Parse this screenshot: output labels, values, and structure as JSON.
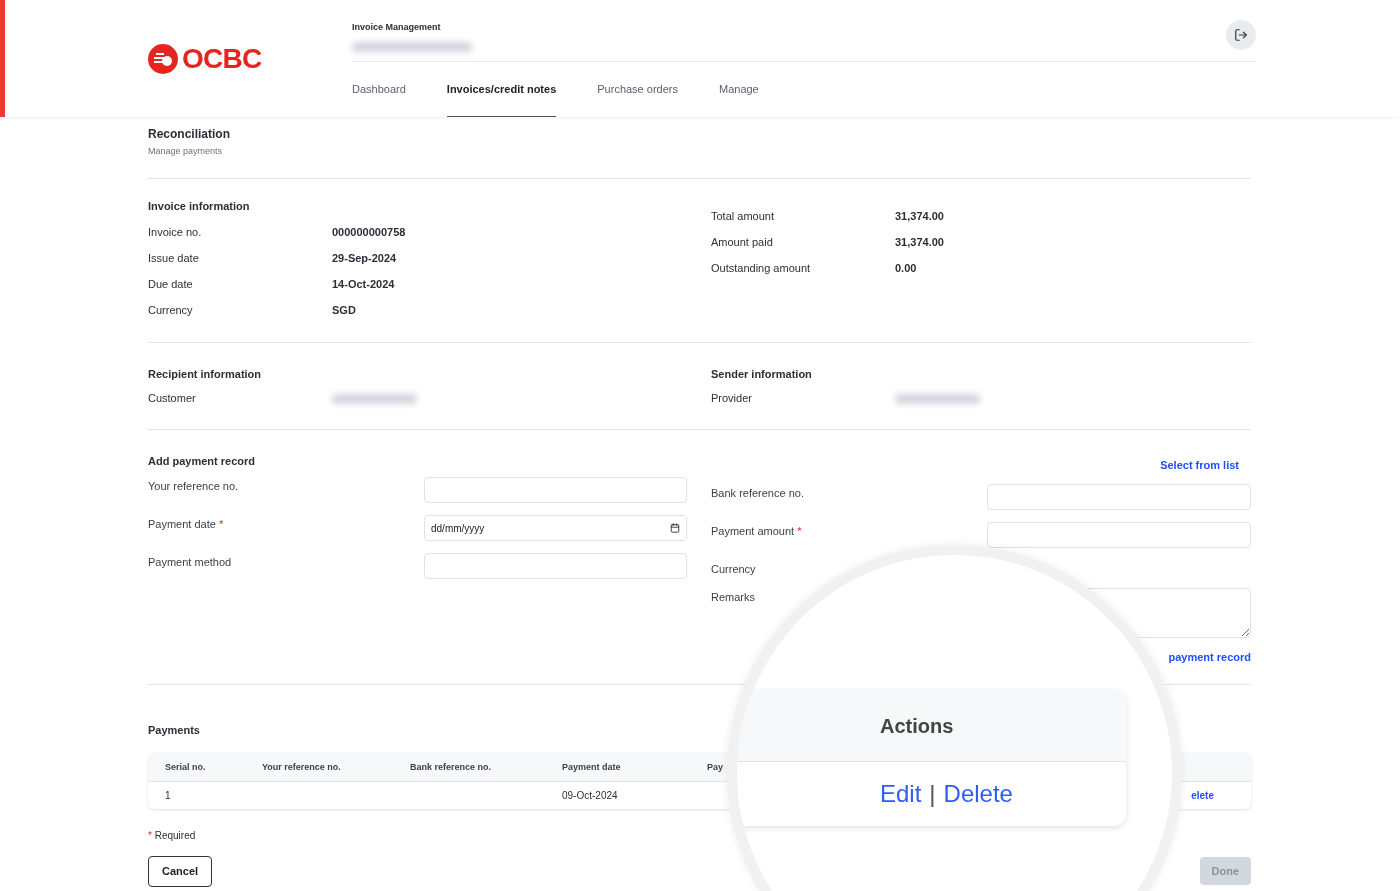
{
  "header": {
    "title": "Invoice Management",
    "logo_text": "OCBC",
    "tabs": [
      {
        "label": "Dashboard",
        "selected": false
      },
      {
        "label": "Invoices/credit notes",
        "selected": true
      },
      {
        "label": "Purchase orders",
        "selected": false
      },
      {
        "label": "Manage",
        "selected": false
      }
    ]
  },
  "page": {
    "title": "Reconciliation",
    "subtitle": "Manage payments"
  },
  "required_mark": "*",
  "invoice_information": {
    "heading": "Invoice information",
    "fields": [
      {
        "label": "Invoice no.",
        "value": "000000000758"
      },
      {
        "label": "Issue date",
        "value": "29-Sep-2024"
      },
      {
        "label": "Due date",
        "value": "14-Oct-2024"
      },
      {
        "label": "Currency",
        "value": "SGD"
      }
    ],
    "totals": [
      {
        "label": "Total amount",
        "value": "31,374.00"
      },
      {
        "label": "Amount paid",
        "value": "31,374.00"
      },
      {
        "label": "Outstanding amount",
        "value": "0.00"
      }
    ]
  },
  "recipient_information": {
    "heading": "Recipient information",
    "label": "Customer"
  },
  "sender_information": {
    "heading": "Sender information",
    "label": "Provider"
  },
  "payment_form": {
    "heading": "Add payment record",
    "select_link": "Select from list",
    "left_fields": [
      {
        "label": "Your reference no.",
        "required": false,
        "kind": "text"
      },
      {
        "label": "Payment date",
        "required": true,
        "kind": "date",
        "placeholder": "dd/mm/yyyy"
      },
      {
        "label": "Payment method",
        "required": false,
        "kind": "text"
      }
    ],
    "right_fields": [
      {
        "label": "Bank reference no.",
        "required": false,
        "kind": "text"
      },
      {
        "label": "Payment amount",
        "required": true,
        "kind": "text"
      },
      {
        "label": "Currency",
        "required": false,
        "kind": "hidden"
      },
      {
        "label": "Remarks",
        "required": false,
        "kind": "textarea"
      }
    ],
    "add_link": "payment record"
  },
  "payments": {
    "heading": "Payments",
    "columns": [
      "Serial no.",
      "Your reference no.",
      "Bank reference no.",
      "Payment date",
      "Pay"
    ],
    "rows": [
      {
        "cells": [
          "1",
          "",
          "",
          "09-Oct-2024"
        ],
        "action": "elete"
      }
    ]
  },
  "required_note": "Required",
  "buttons": {
    "cancel": {
      "label": "Cancel",
      "disabled": false
    },
    "done": {
      "label": "Done",
      "disabled": true
    }
  },
  "magnifier": {
    "column": "Actions",
    "actions": [
      "Edit",
      "Delete"
    ],
    "separator": "|"
  }
}
